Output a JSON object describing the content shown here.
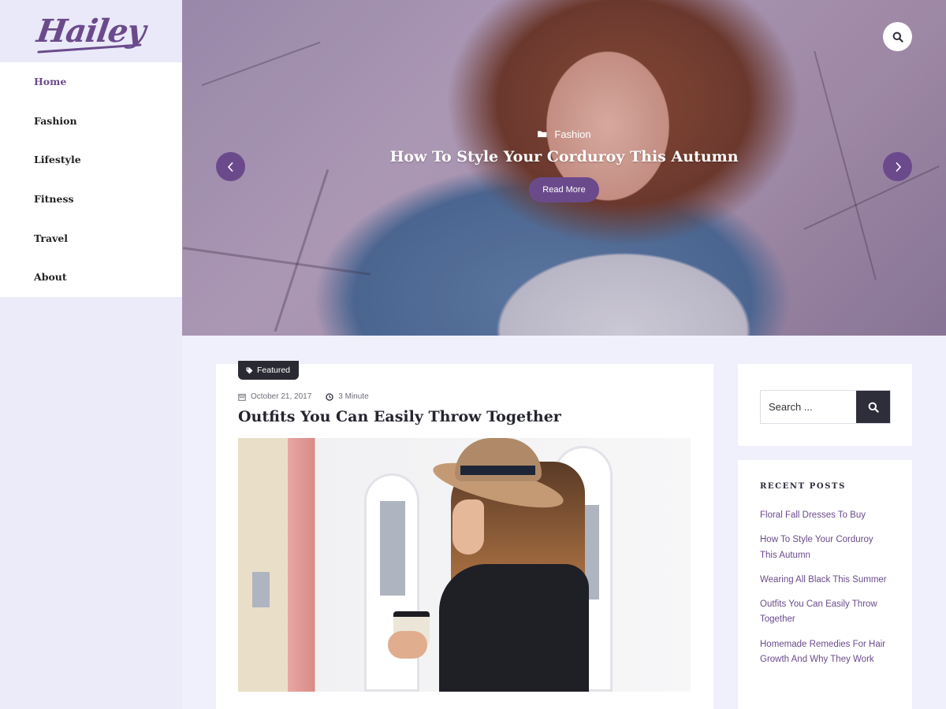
{
  "site": {
    "logo": "Hailey"
  },
  "nav": {
    "items": [
      {
        "label": "Home"
      },
      {
        "label": "Fashion"
      },
      {
        "label": "Lifestyle"
      },
      {
        "label": "Fitness"
      },
      {
        "label": "Travel"
      },
      {
        "label": "About"
      }
    ]
  },
  "hero": {
    "category": "Fashion",
    "title": "How To Style Your Corduroy This Autumn",
    "read_more": "Read More",
    "prev_icon": "chevron-left-icon",
    "next_icon": "chevron-right-icon",
    "search_icon": "search-icon"
  },
  "post": {
    "tag": "Featured",
    "date": "October 21, 2017",
    "read_time": "3 Minute",
    "title": "Outfits You Can Easily Throw Together"
  },
  "search_widget": {
    "placeholder": "Search ..."
  },
  "recent_posts": {
    "title": "RECENT POSTS",
    "items": [
      {
        "label": "Floral Fall Dresses To Buy"
      },
      {
        "label": "How To Style Your Corduroy This Autumn"
      },
      {
        "label": "Wearing All Black This Summer"
      },
      {
        "label": "Outfits You Can Easily Throw Together"
      },
      {
        "label": "Homemade Remedies For Hair Growth And Why They Work"
      }
    ]
  },
  "colors": {
    "accent": "#6b4a8c",
    "background": "#f0f0fc",
    "dark": "#2e2d3a"
  }
}
